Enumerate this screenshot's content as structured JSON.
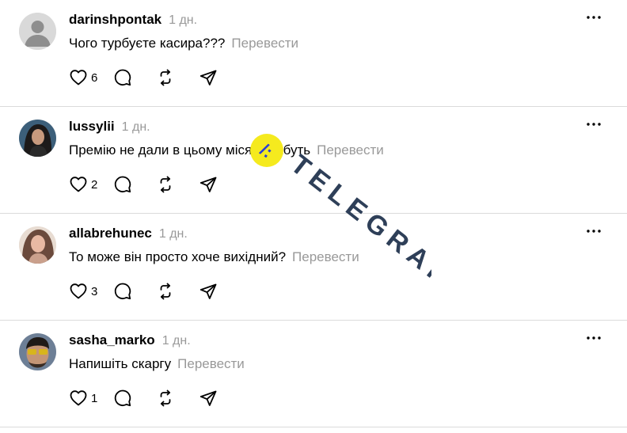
{
  "comments": [
    {
      "username": "darinshpontak",
      "time": "1 дн.",
      "text": "Чого турбуєте касира???",
      "translate": "Перевести",
      "likes": "6",
      "avatar": "default"
    },
    {
      "username": "lussylii",
      "time": "1 дн.",
      "text": "Премію не дали в цьому місяці мабуть",
      "translate": "Перевести",
      "likes": "2",
      "avatar": "photo"
    },
    {
      "username": "allabrehunec",
      "time": "1 дн.",
      "text": "То може він просто хоче вихідний?",
      "translate": "Перевести",
      "likes": "3",
      "avatar": "photo"
    },
    {
      "username": "sasha_marko",
      "time": "1 дн.",
      "text": "Напишіть скаргу",
      "translate": "Перевести",
      "likes": "1",
      "avatar": "photo"
    }
  ],
  "icons": {
    "more": "more-horizontal-icon",
    "like": "heart-icon",
    "reply": "comment-bubble-icon",
    "repost": "repost-icon",
    "share": "send-icon"
  },
  "watermark": {
    "text": "TELEGRAF",
    "accent": "#f5ea1e",
    "color": "#2e3f58"
  },
  "colors": {
    "muted": "#999999",
    "divider": "#dbdbdb"
  }
}
